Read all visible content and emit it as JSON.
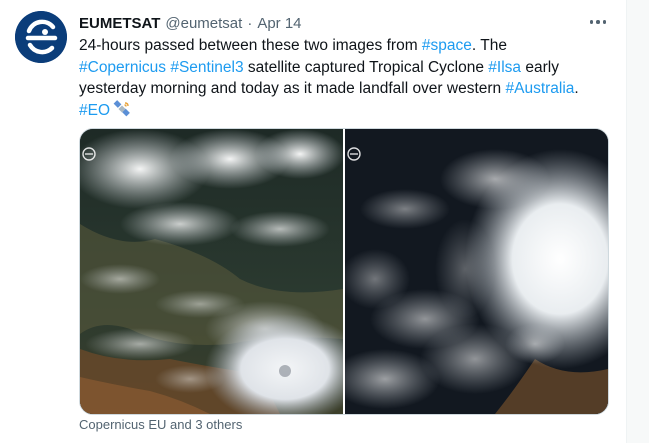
{
  "tweet": {
    "display_name": "EUMETSAT",
    "handle": "@eumetsat",
    "separator": "·",
    "date": "Apr 14",
    "text": {
      "line1": {
        "t1": "24-hours passed between these two images from ",
        "h1": "#space",
        "t2": ". The"
      },
      "line2": {
        "h1": "#Copernicus",
        "t1": " ",
        "h2": "#Sentinel3",
        "t2": " satellite captured Tropical Cyclone ",
        "h3": "#Ilsa",
        "t3": " early"
      },
      "line3": {
        "t1": "yesterday morning and today as it made landfall over western ",
        "h1": "#Australia",
        "t2": "."
      },
      "line4": {
        "h1": "#EO"
      }
    },
    "footer": "Copernicus EU and 3 others"
  },
  "icons": {
    "avatar": "eumetsat-logo-icon",
    "more": "more-options-icon",
    "satellite": "satellite-emoji-icon"
  },
  "colors": {
    "hashtag": "#1d9bf0",
    "text": "#0f1419",
    "secondary": "#536471",
    "avatar_bg": "#0b3d7a"
  }
}
